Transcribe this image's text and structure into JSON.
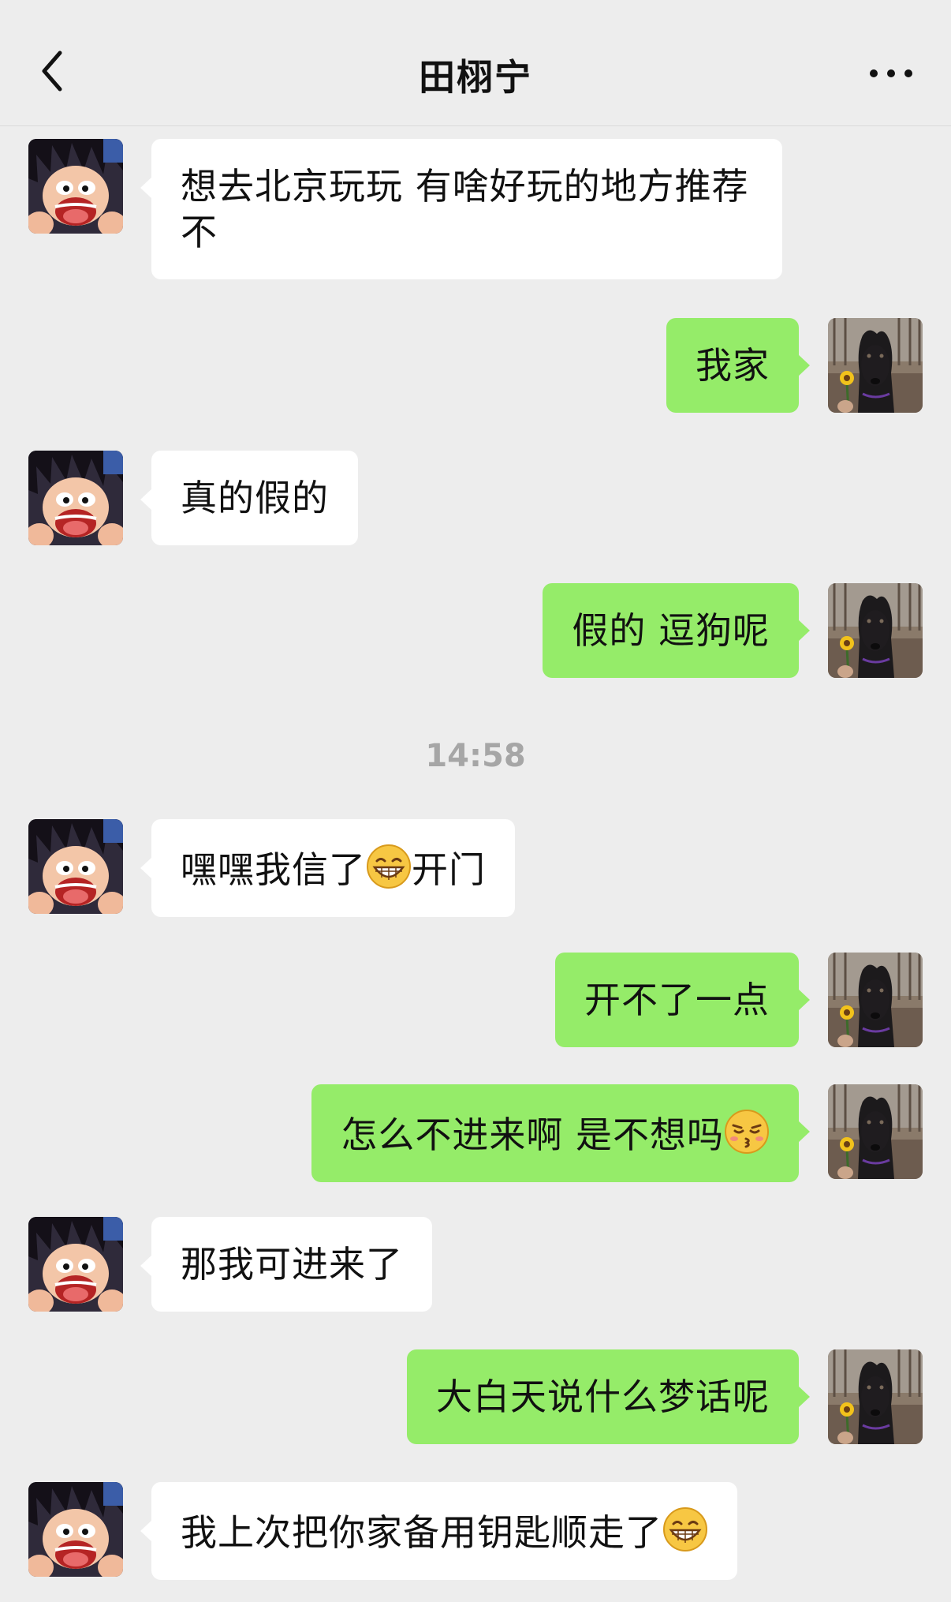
{
  "header": {
    "title": "田栩宁",
    "back_icon": "chevron-left-icon",
    "more_icon": "more-dots-icon"
  },
  "colors": {
    "background": "#ededed",
    "incoming_bubble": "#ffffff",
    "outgoing_bubble": "#95ec69",
    "timestamp": "#a6a6a6"
  },
  "messages": [
    {
      "side": "in",
      "text": "想去北京玩玩 有啥好玩的地方推荐不"
    },
    {
      "side": "out",
      "text": "我家"
    },
    {
      "side": "in",
      "text": "真的假的"
    },
    {
      "side": "out",
      "text": "假的 逗狗呢"
    },
    {
      "side": "in",
      "text_before": "嘿嘿我信了",
      "emoji": "grinning-emoji",
      "text_after": "开门"
    },
    {
      "side": "out",
      "text": "开不了一点"
    },
    {
      "side": "out",
      "text_before": "怎么不进来啊 是不想吗",
      "emoji": "kissing-emoji"
    },
    {
      "side": "in",
      "text": "那我可进来了"
    },
    {
      "side": "out",
      "text": "大白天说什么梦话呢"
    },
    {
      "side": "in",
      "text_before": "我上次把你家备用钥匙顺走了",
      "emoji": "grinning-emoji"
    }
  ],
  "timestamp": "14:58"
}
